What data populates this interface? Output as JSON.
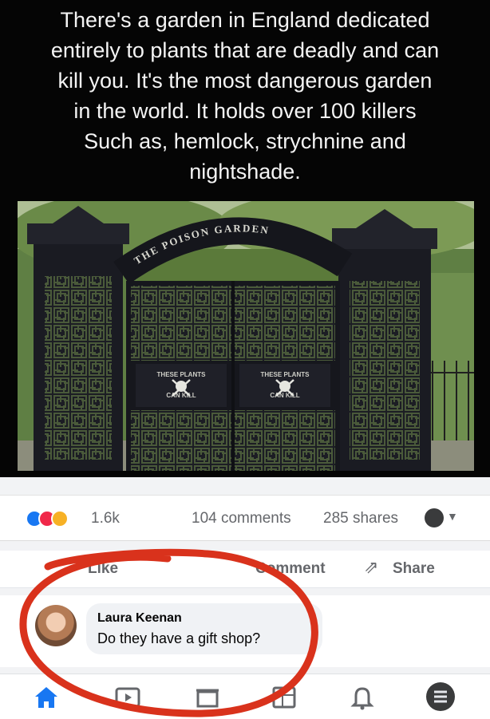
{
  "caption": {
    "lines": [
      "There's a garden in England dedicated",
      "entirely to plants that are deadly and can",
      "kill you. It's the most dangerous garden",
      "in the world. It holds over 100 killers",
      "Such as, hemlock, strychnine and",
      "nightshade."
    ]
  },
  "photo": {
    "arch_sign": "THE POISON GARDEN",
    "gate_panel_left_top": "THESE PLANTS",
    "gate_panel_left_bottom": "CAN KILL",
    "gate_panel_right_top": "THESE PLANTS",
    "gate_panel_right_bottom": "CAN KILL",
    "colors": {
      "iron": "#1a1b22",
      "foliage": "#4c6b36",
      "sky": "#b7c7a0"
    }
  },
  "post": {
    "reaction_count": "1.6k",
    "comments": "104 comments",
    "shares": "285 shares",
    "actions": {
      "like": "Like",
      "comment": "Comment",
      "share": "Share"
    },
    "comment": {
      "author": "Laura Keenan",
      "text": "Do they have a gift shop?"
    },
    "tabs": [
      "home-icon",
      "watch-icon",
      "marketplace-icon",
      "groups-icon",
      "notifications-icon",
      "menu-icon"
    ],
    "accent": "#1877f2",
    "annotation_color": "#d9321c"
  }
}
